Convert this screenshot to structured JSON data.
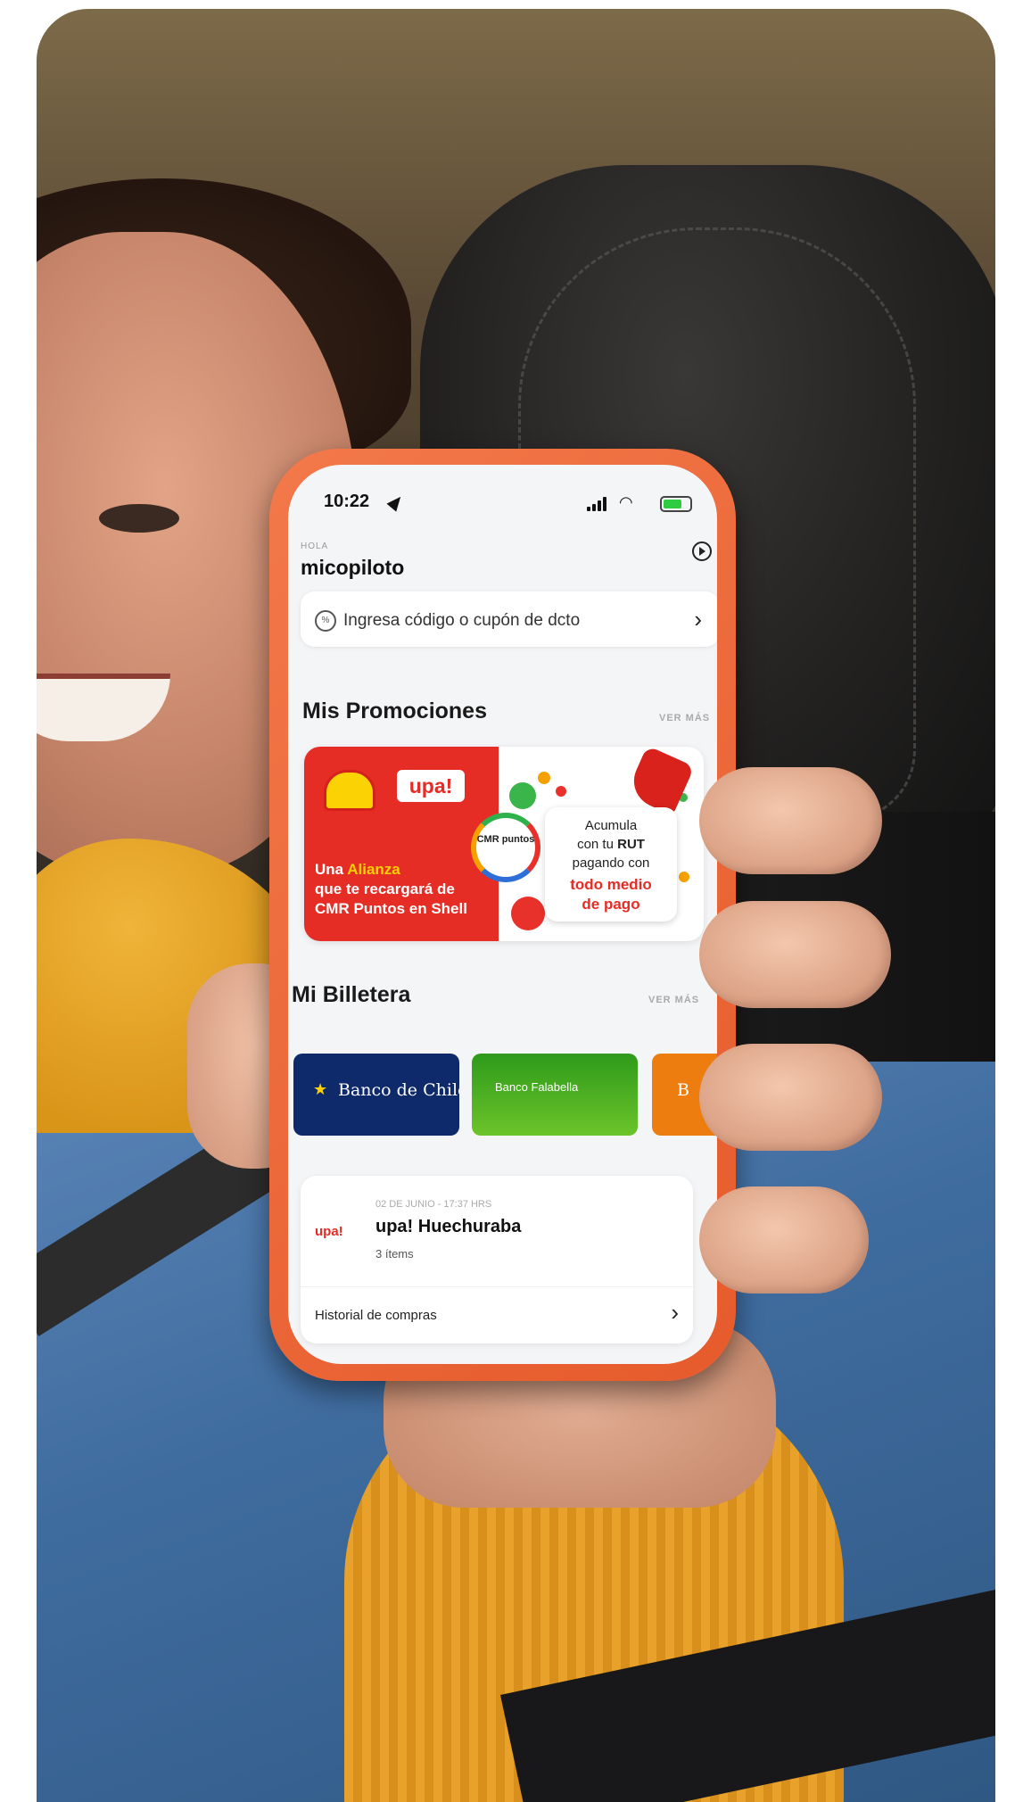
{
  "status_bar": {
    "time": "10:22"
  },
  "greeting": {
    "label": "HOLA",
    "user": "micopiloto"
  },
  "coupon": {
    "icon": "percent-icon",
    "symbol": "%",
    "text": "Ingresa código o cupón de dcto"
  },
  "promotions": {
    "title": "Mis Promociones",
    "more": "VER MÁS",
    "banner": {
      "upa_logo": "upa!",
      "cmr_logo": "CMR puntos",
      "lines": [
        "Una",
        "Alianza",
        "que te recargará de",
        "CMR Puntos en Shell"
      ],
      "card_lines": [
        "Acumula",
        "con tu",
        "RUT",
        "pagando con",
        "todo medio",
        "de pago"
      ]
    }
  },
  "wallet": {
    "title": "Mi Billetera",
    "more": "VER MÁS",
    "cards": [
      {
        "label": "Banco de Chile",
        "color": "#0f2a6b"
      },
      {
        "label": "Banco Falabella",
        "color": "#3da21e"
      },
      {
        "label": "B",
        "color": "#ee7d10"
      }
    ]
  },
  "purchase": {
    "logo": "upa!",
    "date": "02 DE JUNIO - 17:37 HRS",
    "store": "upa! Huechuraba",
    "items": "3 ítems",
    "history": "Historial de compras"
  },
  "colors": {
    "phone_case": "#e8612f",
    "brand_red": "#e52c25",
    "shell_yellow": "#fbd305"
  }
}
